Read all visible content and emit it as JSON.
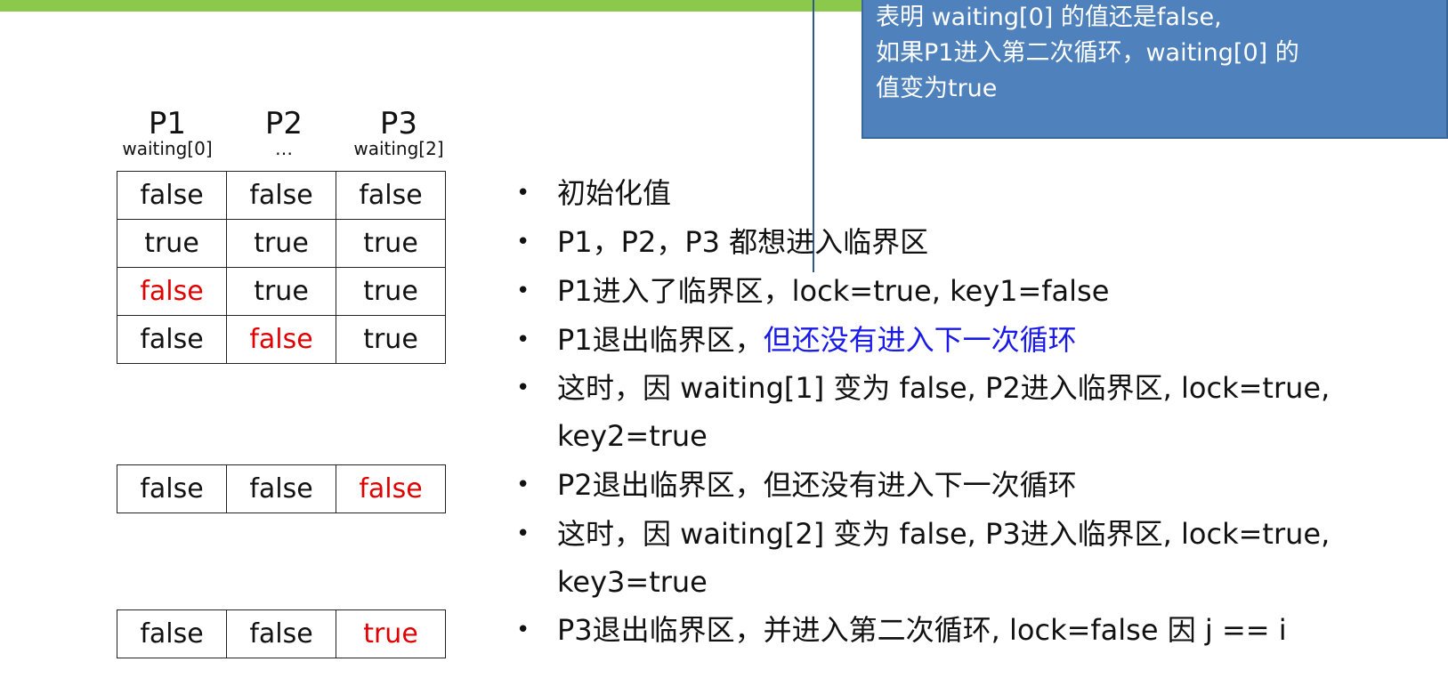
{
  "callout": {
    "line1": "表明 waiting[0] 的值还是false,",
    "line2": "如果P1进入第二次循环，waiting[0] 的",
    "line3": "值变为true"
  },
  "headers": [
    {
      "name": "P1",
      "sub": "waiting[0]"
    },
    {
      "name": "P2",
      "sub": "…"
    },
    {
      "name": "P3",
      "sub": "waiting[2]"
    }
  ],
  "table_main": [
    [
      {
        "v": "false"
      },
      {
        "v": "false"
      },
      {
        "v": "false"
      }
    ],
    [
      {
        "v": "true"
      },
      {
        "v": "true"
      },
      {
        "v": "true"
      }
    ],
    [
      {
        "v": "false",
        "red": true
      },
      {
        "v": "true"
      },
      {
        "v": "true"
      }
    ],
    [
      {
        "v": "false"
      },
      {
        "v": "false",
        "red": true
      },
      {
        "v": "true"
      }
    ]
  ],
  "table_2": [
    {
      "v": "false"
    },
    {
      "v": "false"
    },
    {
      "v": "false",
      "red": true
    }
  ],
  "table_3": [
    {
      "v": "false"
    },
    {
      "v": "false"
    },
    {
      "v": "true",
      "red": true
    }
  ],
  "steps": {
    "s1": "初始化值",
    "s2": "P1，P2，P3 都想进入临界区",
    "s3": "P1进入了临界区，lock=true, key1=false",
    "s4_a": "P1退出临界区，",
    "s4_b": "但还没有进入下一次循环",
    "s5_a": "这时，因 waiting[1] 变为 false, P2进入临界区, lock=true,",
    "s5_b": "key2=true",
    "s6": "P2退出临界区，但还没有进入下一次循环",
    "s7_a": "这时，因 waiting[2] 变为 false, P3进入临界区, lock=true,",
    "s7_b": "key3=true",
    "s8": "P3退出临界区，并进入第二次循环, lock=false 因 j == i"
  },
  "colors": {
    "accent_green": "#8cc84b",
    "callout_blue": "#4f81bd",
    "highlight_red": "#e00000",
    "highlight_blue": "#1a1ae6"
  }
}
